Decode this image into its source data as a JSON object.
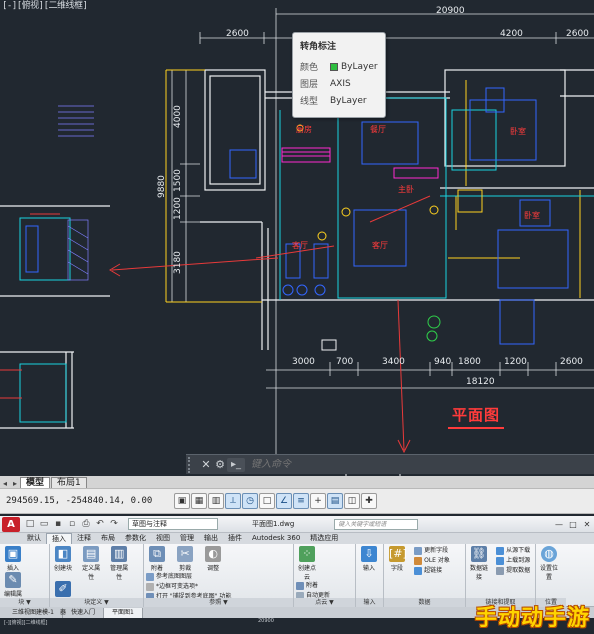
{
  "viewport": {
    "label": "[-][俯视][二维线框]"
  },
  "dimensions": {
    "top_total": "20900",
    "top_segments": [
      "2600",
      "4200",
      "2600"
    ],
    "left_segments": [
      "4000",
      "1500",
      "1200",
      "3180"
    ],
    "left_total": "9880",
    "bottom_segments": [
      "3000",
      "700",
      "3400",
      "940",
      "1800",
      "1200",
      "2600"
    ],
    "bottom_total": "18120"
  },
  "room_labels": [
    "厨房",
    "餐厅",
    "卧室",
    "客厅",
    "卧室",
    "客厅",
    "主卧"
  ],
  "plan_title": "平面图",
  "tooltip": {
    "title": "转角标注",
    "rows": [
      {
        "key": "颜色",
        "value": "ByLayer",
        "swatch": "#2fbf40"
      },
      {
        "key": "图层",
        "value": "AXIS"
      },
      {
        "key": "线型",
        "value": "ByLayer"
      }
    ]
  },
  "command": {
    "placeholder": "键入命令",
    "icon": "command-icon"
  },
  "layout_tabs": {
    "model": "模型",
    "layout1": "布局1"
  },
  "status": {
    "coords": "294569.15, -254840.14, 0.00",
    "buttons": [
      "model-space-icon",
      "grid-icon",
      "snap-icon",
      "ortho-icon",
      "polar-icon",
      "osnap-icon",
      "otrack-icon",
      "lineweight-icon",
      "transparency-icon",
      "selection-cycle-icon",
      "annotation-icon",
      "plus-icon"
    ]
  },
  "app": {
    "logo": "A",
    "workspace": "草图与注释",
    "doc_title": "平面图1.dwg",
    "search_placeholder": "键入关键字或短语",
    "ribbon_tabs": [
      "默认",
      "插入",
      "注释",
      "布局",
      "参数化",
      "视图",
      "管理",
      "输出",
      "插件",
      "Autodesk 360",
      "精选应用"
    ],
    "active_tab": "插入",
    "panels": {
      "block": {
        "title": "块 ▼",
        "buttons": [
          "插入",
          "编辑属性"
        ]
      },
      "block_def": {
        "title": "块定义 ▼",
        "buttons": [
          "创建块",
          "定义属性",
          "管理属性",
          "块编辑器"
        ]
      },
      "reference": {
        "title": "参照 ▼",
        "buttons": [
          "附着",
          "剪裁",
          "调整"
        ],
        "small": [
          "参考底图图层",
          "*边框可变选项*",
          "打开 \"捕捉到参考底图\" 功能"
        ]
      },
      "pointcloud": {
        "title": "点云 ▼",
        "buttons": [
          "创建点云"
        ],
        "small": [
          "附着",
          "自动更新"
        ]
      },
      "input": {
        "title": "输入",
        "buttons": [
          "输入"
        ]
      },
      "data": {
        "title": "数据",
        "buttons": [
          "字段"
        ],
        "small": [
          "更新字段",
          "OLE 对象",
          "超链接"
        ]
      },
      "linking": {
        "title": "链接和提取",
        "buttons": [
          "数据链接"
        ],
        "small": [
          "从源下载",
          "上载到源",
          "提取数据"
        ]
      },
      "location": {
        "title": "位置",
        "buttons": [
          "设置位置"
        ]
      }
    },
    "doc_tabs": [
      "三维视图建模-1",
      "快速入门",
      "平面图1"
    ],
    "active_doc": "平面图1",
    "mini_label": "[-][俯视][二维线框]",
    "mini_dim": "20900"
  },
  "watermark": "手动动手游"
}
